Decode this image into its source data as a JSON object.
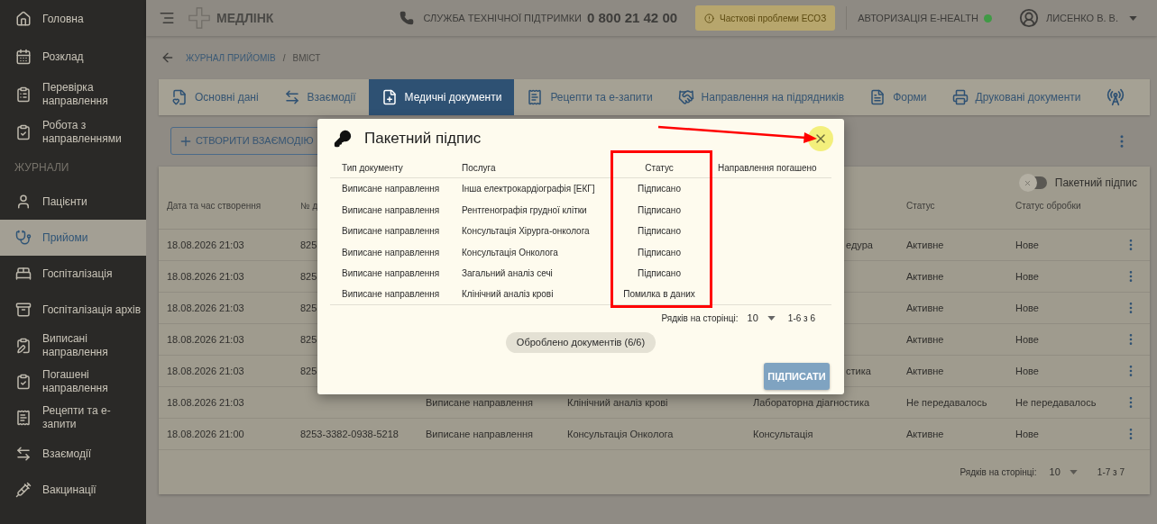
{
  "sidebar": {
    "items": [
      {
        "label": "Головна",
        "selected": false
      },
      {
        "label": "Розклад",
        "selected": false
      },
      {
        "label": "Перевірка направлення",
        "selected": false
      },
      {
        "label": "Робота з направленнями",
        "selected": false
      },
      {
        "kind": "section",
        "label": "ЖУРНАЛИ"
      },
      {
        "label": "Пацієнти",
        "selected": false
      },
      {
        "label": "Прийоми",
        "selected": true
      },
      {
        "label": "Госпіталізація",
        "selected": false
      },
      {
        "label": "Госпіталізація архів",
        "selected": false
      },
      {
        "label": "Виписані направлення",
        "selected": false
      },
      {
        "label": "Погашені направлення",
        "selected": false
      },
      {
        "label": "Рецепти та е-запити",
        "selected": false
      },
      {
        "label": "Взаємодії",
        "selected": false
      },
      {
        "label": "Вакцинації",
        "selected": false
      }
    ]
  },
  "header": {
    "logo": "МЕДЛІНК",
    "support_label": "СЛУЖБА ТЕХНІЧНОЇ ПІДТРИМКИ",
    "phone": "0 800 21 42 00",
    "alert": "Часткові проблеми ЕСОЗ",
    "auth": {
      "label": "АВТОРИЗАЦІЯ E-HEALTH",
      "color": "#3f9a45"
    },
    "user": "ЛИСЕНКО В. В."
  },
  "breadcrumb": {
    "link": "ЖУРНАЛ ПРИЙОМІВ",
    "separator": "/",
    "current": "ВМІСТ"
  },
  "tabs": [
    {
      "label": "Основні дані",
      "selected": false
    },
    {
      "label": "Взаємодії",
      "selected": false
    },
    {
      "label": "Медичні документи",
      "selected": true
    },
    {
      "label": "Рецепти та е-запити",
      "selected": false
    },
    {
      "label": "Направлення на підрядників",
      "selected": false
    },
    {
      "label": "Форми",
      "selected": false
    },
    {
      "label": "Друковані документи",
      "selected": false
    }
  ],
  "create_button": "СТВОРИТИ ВЗАЄМОДІЮ",
  "batch_toggle": {
    "label": "Пакетний підпис",
    "on": false
  },
  "table": {
    "columns": [
      "Дата та час створення",
      "№ д",
      "",
      "",
      "",
      "Статус",
      "Статус обробки"
    ],
    "rows": [
      {
        "date": "18.08.2026 21:03",
        "number": "825",
        "category": "едура",
        "status": "Активне",
        "processing": "Нове"
      },
      {
        "date": "18.08.2026 21:03",
        "number": "825",
        "status": "Активне",
        "processing": "Нове"
      },
      {
        "date": "18.08.2026 21:03",
        "number": "825",
        "status": "Активне",
        "processing": "Нове"
      },
      {
        "date": "18.08.2026 21:03",
        "number": "825",
        "status": "Активне",
        "processing": "Нове"
      },
      {
        "date": "18.08.2026 21:03",
        "number": "825",
        "category": "стика",
        "status": "Активне",
        "processing": "Нове"
      },
      {
        "date": "18.08.2026 21:03",
        "doc_type": "Виписане направлення",
        "service": "Клінічний аналіз крові",
        "category": "Лабораторна діагностика",
        "status": "Не передавалось",
        "processing": "Не передавалось"
      },
      {
        "date": "18.08.2026 21:00",
        "number": "8253-3382-0938-5218",
        "doc_type": "Виписане направлення",
        "service": "Консультація Онколога",
        "category": "Консультація",
        "status": "Активне",
        "processing": "Нове"
      }
    ],
    "pagination": {
      "label": "Рядків на сторінці:",
      "per_page": "10",
      "range": "1-7 з 7"
    }
  },
  "dialog": {
    "title": "Пакетний підпис",
    "columns": [
      "Тип документу",
      "Послуга",
      "Статус",
      "Направлення погашено"
    ],
    "rows": [
      {
        "doc_type": "Виписане направлення",
        "service": "Інша електрокардіографія [ЕКГ]",
        "status": "Підписано"
      },
      {
        "doc_type": "Виписане направлення",
        "service": "Рентгенографія грудної клітки",
        "status": "Підписано"
      },
      {
        "doc_type": "Виписане направлення",
        "service": "Консультація Хірурга-онколога",
        "status": "Підписано"
      },
      {
        "doc_type": "Виписане направлення",
        "service": "Консультація Онколога",
        "status": "Підписано"
      },
      {
        "doc_type": "Виписане направлення",
        "service": "Загальний аналіз сечі",
        "status": "Підписано"
      },
      {
        "doc_type": "Виписане направлення",
        "service": "Клінічний аналіз крові",
        "status": "Помилка в даних"
      }
    ],
    "pagination": {
      "label": "Рядків на сторінці:",
      "per_page": "10",
      "range": "1-6 з 6"
    },
    "progress": "Оброблено документів (6/6)",
    "sign_button": "ПІДПИСАТИ"
  }
}
